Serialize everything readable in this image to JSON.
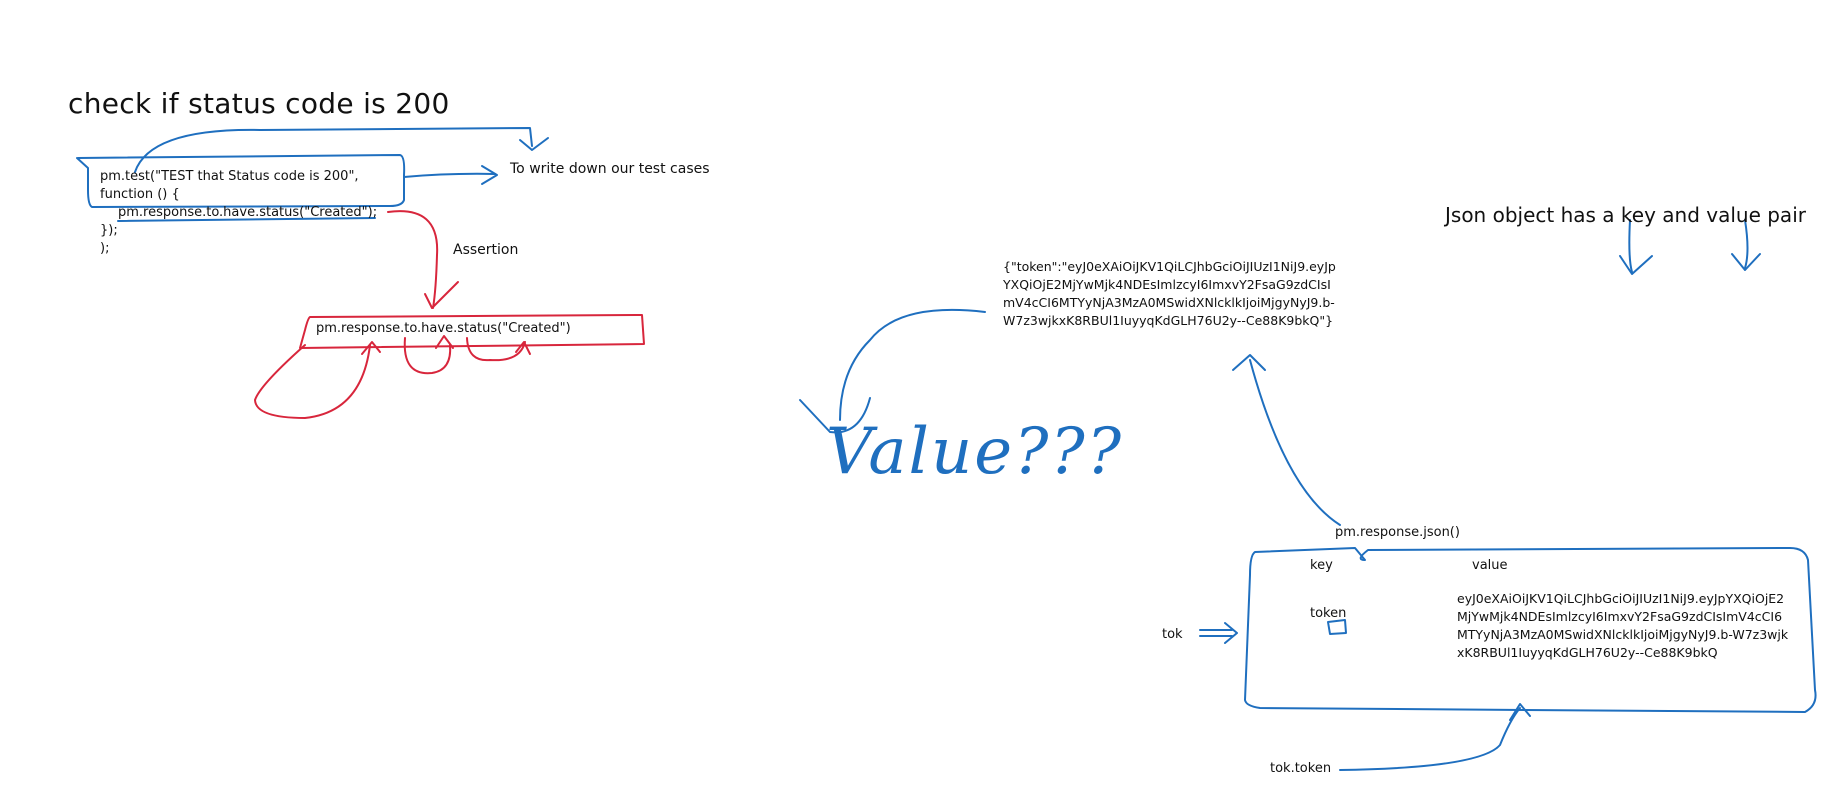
{
  "title": "check if status code is 200",
  "code": {
    "line1": "pm.test(\"TEST that Status code is 200\",",
    "line2": "function () {",
    "line3": "pm.response.to.have.status(\"Created\");",
    "line4": "});",
    "line5": ");"
  },
  "notes": {
    "write_test_cases": "To write down our test cases",
    "assertion": "Assertion"
  },
  "assertion_box": "pm.response.to.have.status(\"Created\")",
  "json_note": "Json object has a key and value pair",
  "json_response": "{\"token\":\"eyJ0eXAiOiJKV1QiLCJhbGciOiJIUzI1NiJ9.eyJpYXQiOjE2MjYwMjk4NDEsImlzcyI6ImxvY2FsaG9zdCIsImV4cCI6MTYyNjA3MzA0MSwidXNlcklkIjoiMjgyNyJ9.b-W7z3wjkxK8RBUl1IuyyqKdGLH76U2y--Ce88K9bkQ\"}",
  "value_label": "Value???",
  "response_call": "pm.response.json()",
  "table": {
    "key_header": "key",
    "value_header": "value",
    "key": "token",
    "value": "eyJ0eXAiOiJKV1QiLCJhbGciOiJIUzI1NiJ9.eyJpYXQiOjE2MjYwMjk4NDEsImlzcyI6ImxvY2FsaG9zdCIsImV4cCI6MTYyNjA3MzA0MSwidXNlcklkIjoiMjgyNyJ9.b-W7z3wjkxK8RBUl1IuyyqKdGLH76U2y--Ce88K9bkQ"
  },
  "variable": "tok",
  "accessor": "tok.token",
  "colors": {
    "blue_ink": "#1f6fbf",
    "red_ink": "#d8263c"
  }
}
